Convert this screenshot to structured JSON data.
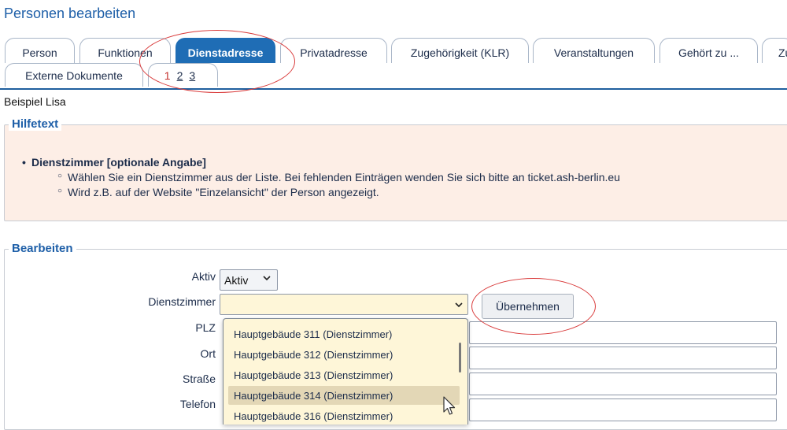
{
  "page": {
    "title": "Personen bearbeiten"
  },
  "tabs": [
    {
      "label": "Person"
    },
    {
      "label": "Funktionen"
    },
    {
      "label": "Dienstadresse"
    },
    {
      "label": "Privatadresse"
    },
    {
      "label": "Zugehörigkeit (KLR)"
    },
    {
      "label": "Veranstaltungen"
    },
    {
      "label": "Gehört zu ..."
    },
    {
      "label": "Zu"
    }
  ],
  "tabs_row2": {
    "label": "Externe Dokumente"
  },
  "pager": {
    "current": "1",
    "p2": "2",
    "p3": "3"
  },
  "person": {
    "name": "Beispiel  Lisa"
  },
  "help": {
    "legend": "Hilfetext",
    "item_title": "Dienstzimmer [optionale Angabe]",
    "sub1": "Wählen Sie ein Dienstzimmer aus der Liste. Bei fehlenden Einträgen wenden Sie sich bitte an ticket.ash-berlin.eu",
    "sub2": "Wird z.B. auf der Website \"Einzelansicht\" der Person angezeigt."
  },
  "edit": {
    "legend": "Bearbeiten",
    "aktiv_label": "Aktiv",
    "aktiv_value": "Aktiv",
    "dienstzimmer_label": "Dienstzimmer",
    "dienstzimmer_value": "",
    "apply_button": "Übernehmen",
    "plz_label": "PLZ",
    "ort_label": "Ort",
    "strasse_label": "Straße",
    "telefon_label": "Telefon"
  },
  "dropdown": {
    "options": [
      "Hauptgebäude 311 (Dienstzimmer)",
      "Hauptgebäude 312 (Dienstzimmer)",
      "Hauptgebäude 313 (Dienstzimmer)",
      "Hauptgebäude 314 (Dienstzimmer)",
      "Hauptgebäude 316 (Dienstzimmer)"
    ],
    "highlighted": "Hauptgebäude 314 (Dienstzimmer)"
  },
  "colors": {
    "accent": "#1f6db5",
    "heading": "#1e5fa8",
    "help_bg": "#fdeee6",
    "field_bg": "#fef6d8",
    "annotation": "#d93a3a"
  }
}
